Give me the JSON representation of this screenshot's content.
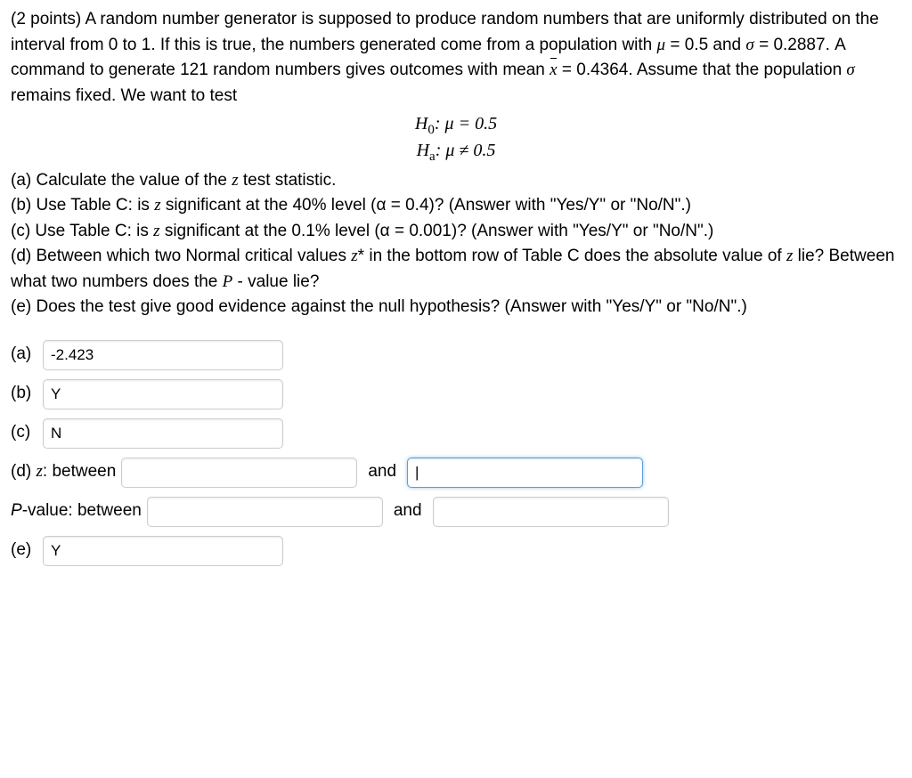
{
  "question": {
    "points": "(2 points)",
    "intro": "A random number generator is supposed to produce random numbers that are uniformly distributed on the interval from 0 to 1. If this is true, the numbers generated come from a population with",
    "mu": "μ",
    "mu_val": "= 0.5 and",
    "sigma": "σ",
    "sigma_val": "= 0.2887. A command to generate 121 random numbers gives outcomes with mean",
    "xbar_val": "= 0.4364. Assume that the population",
    "sigma2": "σ",
    "remains": "remains fixed. We want to test"
  },
  "hypotheses": {
    "h0": "H",
    "h0_sub": "0",
    "h0_body": ": μ = 0.5",
    "ha": "H",
    "ha_sub": "a",
    "ha_body": ": μ ≠ 0.5"
  },
  "parts": {
    "a": "(a) Calculate the value of the",
    "a_var": "z",
    "a_end": "test statistic.",
    "b": "(b) Use Table C: is",
    "b_var": "z",
    "b_end": "significant at the 40% level (α = 0.4)? (Answer with \"Yes/Y\" or \"No/N\".)",
    "c": "(c) Use Table C: is",
    "c_var": "z",
    "c_end": "significant at the 0.1% level (α = 0.001)? (Answer with \"Yes/Y\" or \"No/N\".)",
    "d": "(d) Between which two Normal critical values",
    "d_var": "z",
    "d_star": "*",
    "d_mid": "in the bottom row of Table C does the absolute value of",
    "d_var2": "z",
    "d_mid2": "lie? Between what two numbers does the",
    "d_pvar": "P",
    "d_end": "- value lie?",
    "e": "(e) Does the test give good evidence against the null hypothesis? (Answer with \"Yes/Y\" or \"No/N\".)"
  },
  "answers": {
    "a_label": "(a)",
    "a_value": "-2.423",
    "b_label": "(b)",
    "b_value": "Y",
    "c_label": "(c)",
    "c_value": "N",
    "d_label": "(d)",
    "d_z_label": "z",
    "d_between": ": between",
    "d_z1": "",
    "d_z2": "|",
    "and": "and",
    "p_label": "P",
    "p_value_label": "-value: between",
    "p1": "",
    "p2": "",
    "e_label": "(e)",
    "e_value": "Y"
  }
}
